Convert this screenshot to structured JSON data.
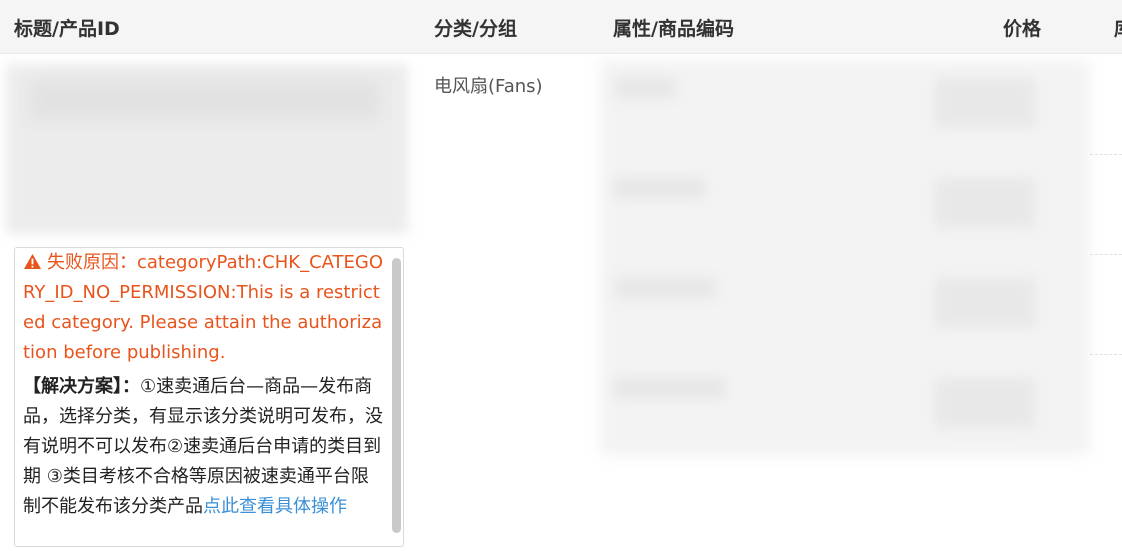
{
  "header": {
    "title_col": "标题/产品ID",
    "category_col": "分类/分组",
    "attr_col": "属性/商品编码",
    "price_col": "价格",
    "more_col": "库"
  },
  "row": {
    "category": "电风扇(Fans)",
    "error": {
      "reason": "失败原因：categoryPath:CHK_CATEGORY_ID_NO_PERMISSION:This is a restricted category. Please attain the authorization before publishing.",
      "solution_label": "【解决方案】：",
      "solution_text": "①速卖通后台—商品—发布商品，选择分类，有显示该分类说明可发布，没有说明不可以发布②速卖通后台申请的类目到期 ③类目考核不合格等原因被速卖通平台限制不能发布该分类产品",
      "link_text": "点此查看具体操作"
    }
  },
  "colors": {
    "error_text": "#e8541c",
    "link": "#3b8fd6",
    "header_bg": "#f5f5f5"
  },
  "icons": {
    "warning": "warning-triangle-icon"
  }
}
